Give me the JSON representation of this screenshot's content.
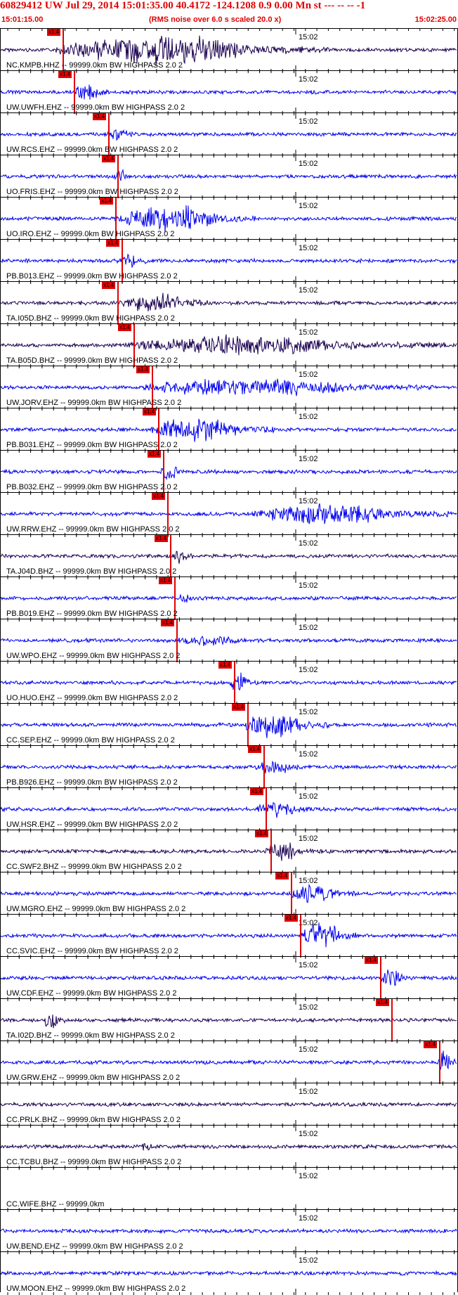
{
  "header": {
    "title": "60829412 UW Jul 29, 2014 15:01:35.00   40.4172 -124.1208  0.9 0.00 Mn st --- -- --  -1",
    "start_time": "15:01:15.00",
    "noise_note": "(RMS noise over 6.0 s scaled 20.0 x)",
    "end_time": "15:02:25.00"
  },
  "minute_tick_label": "15:02",
  "colors": {
    "blue_trace": "#0000ee",
    "dark_trace": "#1a0050",
    "pick": "#e00000",
    "title": "#e00000"
  },
  "traces": [
    {
      "label": "NC.KMPB.HHZ -- 99999.0km BW  HIGHPASS  2.0  2",
      "pick_tag": "x1.4",
      "color": "dark",
      "pick": 0.135,
      "amp": 0.9,
      "burst": [
        0.12,
        0.72
      ]
    },
    {
      "label": "UW.UWFH.EHZ -- 99999.0km BW  HIGHPASS  2.0  2",
      "pick_tag": "x1.4",
      "color": "blue",
      "pick": 0.16,
      "amp": 0.5,
      "burst": [
        0.16,
        0.24
      ]
    },
    {
      "label": "UW.RCS.EHZ -- 99999.0km BW  HIGHPASS  2.0  2",
      "pick_tag": "x1.4",
      "color": "blue",
      "pick": 0.235,
      "amp": 0.35,
      "burst": [
        0.23,
        0.3
      ]
    },
    {
      "label": "UO.FRIS.EHZ -- 99999.0km BW  HIGHPASS  2.0  2",
      "pick_tag": "x1.4",
      "color": "blue",
      "pick": 0.255,
      "amp": 0.5,
      "burst": [
        0.25,
        0.28
      ]
    },
    {
      "label": "UO.IRO.EHZ -- 99999.0km BW  HIGHPASS  2.0  2",
      "pick_tag": "x1.4",
      "color": "blue",
      "pick": 0.25,
      "amp": 0.8,
      "burst": [
        0.25,
        0.56
      ]
    },
    {
      "label": "PB.B013.EHZ -- 99999.0km BW  HIGHPASS  2.0  2",
      "pick_tag": "x1.4",
      "color": "blue",
      "pick": 0.265,
      "amp": 0.45,
      "burst": [
        0.26,
        0.32
      ]
    },
    {
      "label": "TA.I05D.BHZ -- 99999.0km BW  HIGHPASS  2.0  2",
      "pick_tag": "x1.4",
      "color": "dark",
      "pick": 0.255,
      "amp": 0.6,
      "burst": [
        0.26,
        0.46
      ]
    },
    {
      "label": "TA.B05D.BHZ -- 99999.0km BW  HIGHPASS  2.0  2",
      "pick_tag": "x1.4",
      "color": "dark",
      "pick": 0.29,
      "amp": 0.55,
      "burst": [
        0.28,
        0.98
      ]
    },
    {
      "label": "UW.JORV.EHZ -- 99999.0km BW  HIGHPASS  2.0  2",
      "pick_tag": "x1.4",
      "color": "blue",
      "pick": 0.33,
      "amp": 0.55,
      "burst": [
        0.31,
        0.95
      ]
    },
    {
      "label": "PB.B031.EHZ -- 99999.0km BW  HIGHPASS  2.0  2",
      "pick_tag": "x1.4",
      "color": "blue",
      "pick": 0.345,
      "amp": 0.75,
      "burst": [
        0.33,
        0.6
      ]
    },
    {
      "label": "PB.B032.EHZ -- 99999.0km BW  HIGHPASS  2.0  2",
      "pick_tag": "x1.4",
      "color": "blue",
      "pick": 0.355,
      "amp": 0.6,
      "burst": [
        0.35,
        0.4
      ]
    },
    {
      "label": "UW.RRW.EHZ -- 99999.0km BW  HIGHPASS  2.0  2",
      "pick_tag": "x1.4",
      "color": "blue",
      "pick": 0.365,
      "amp": 0.65,
      "burst": [
        0.55,
        0.98
      ]
    },
    {
      "label": "TA.J04D.BHZ -- 99999.0km BW  HIGHPASS  2.0  2",
      "pick_tag": "x1.4",
      "color": "dark",
      "pick": 0.37,
      "amp": 0.5,
      "burst": [
        0.38,
        0.42
      ]
    },
    {
      "label": "PB.B019.EHZ -- 99999.0km BW  HIGHPASS  2.0  2",
      "pick_tag": "x1.4",
      "color": "blue",
      "pick": 0.38,
      "amp": 0.25,
      "burst": [
        0.39,
        0.43
      ]
    },
    {
      "label": "UW.WPO.EHZ -- 99999.0km BW  HIGHPASS  2.0  2",
      "pick_tag": "x1.4",
      "color": "blue",
      "pick": 0.385,
      "amp": 0.3,
      "burst": [
        0.39,
        0.55
      ]
    },
    {
      "label": "UO.HUO.EHZ -- 99999.0km BW  HIGHPASS  2.0  2",
      "pick_tag": "x1.4",
      "color": "blue",
      "pick": 0.51,
      "amp": 0.6,
      "burst": [
        0.5,
        0.56
      ]
    },
    {
      "label": "CC.SEP.EHZ -- 99999.0km BW  HIGHPASS  2.0  2",
      "pick_tag": "x1.4",
      "color": "blue",
      "pick": 0.54,
      "amp": 0.8,
      "burst": [
        0.53,
        0.72
      ]
    },
    {
      "label": "PB.B926.EHZ -- 99999.0km BW  HIGHPASS  2.0  2",
      "pick_tag": "x1.4",
      "color": "blue",
      "pick": 0.575,
      "amp": 0.45,
      "burst": [
        0.56,
        0.66
      ]
    },
    {
      "label": "UW.HSR.EHZ -- 99999.0km BW  HIGHPASS  2.0  2",
      "pick_tag": "x1.4",
      "color": "blue",
      "pick": 0.58,
      "amp": 0.5,
      "burst": [
        0.56,
        0.68
      ]
    },
    {
      "label": "CC.SWF2.BHZ -- 99999.0km BW  HIGHPASS  2.0  2",
      "pick_tag": "x1.4",
      "color": "dark",
      "pick": 0.59,
      "amp": 0.55,
      "burst": [
        0.58,
        0.68
      ]
    },
    {
      "label": "UW.MGRO.EHZ -- 99999.0km BW  HIGHPASS  2.0  2",
      "pick_tag": "x1.4",
      "color": "blue",
      "pick": 0.635,
      "amp": 0.55,
      "burst": [
        0.63,
        0.78
      ]
    },
    {
      "label": "CC.SVIC.EHZ -- 99999.0km BW  HIGHPASS  2.0  2",
      "pick_tag": "x1.4",
      "color": "blue",
      "pick": 0.655,
      "amp": 0.85,
      "burst": [
        0.66,
        0.78
      ]
    },
    {
      "label": "UW.CDF.EHZ -- 99999.0km BW  HIGHPASS  2.0  2",
      "pick_tag": "x1.4",
      "color": "blue",
      "pick": 0.83,
      "amp": 0.55,
      "burst": [
        0.83,
        0.9
      ]
    },
    {
      "label": "TA.I02D.BHZ -- 99999.0km BW  HIGHPASS  2.0  2",
      "pick_tag": "x1.4",
      "color": "dark",
      "pick": 0.855,
      "amp": 0.5,
      "burst": [
        0.09,
        0.14
      ]
    },
    {
      "label": "UW.GRW.EHZ -- 99999.0km BW  HIGHPASS  2.0  2",
      "pick_tag": "x1.4",
      "color": "blue",
      "pick": 0.96,
      "amp": 0.8,
      "burst": [
        0.955,
        0.995
      ]
    },
    {
      "label": "CC.PRLK.BHZ -- 99999.0km BW  HIGHPASS  2.0  2",
      "pick_tag": "",
      "color": "dark",
      "pick": null,
      "amp": 0.15,
      "burst": null
    },
    {
      "label": "CC.TCBU.BHZ -- 99999.0km BW  HIGHPASS  2.0  2",
      "pick_tag": "",
      "color": "dark",
      "pick": null,
      "amp": 0.2,
      "burst": [
        0.3,
        0.35
      ]
    },
    {
      "label": "CC.WIFE.BHZ -- 99999.0km",
      "pick_tag": "",
      "color": "none",
      "pick": null,
      "amp": 0,
      "burst": null
    },
    {
      "label": "UW.BEND.EHZ -- 99999.0km BW  HIGHPASS  2.0  2",
      "pick_tag": "",
      "color": "blue",
      "pick": null,
      "amp": 0.2,
      "burst": null
    },
    {
      "label": "UW.MOON.EHZ -- 99999.0km BW  HIGHPASS  2.0  2",
      "pick_tag": "",
      "color": "blue",
      "pick": null,
      "amp": 0.2,
      "burst": null
    }
  ]
}
